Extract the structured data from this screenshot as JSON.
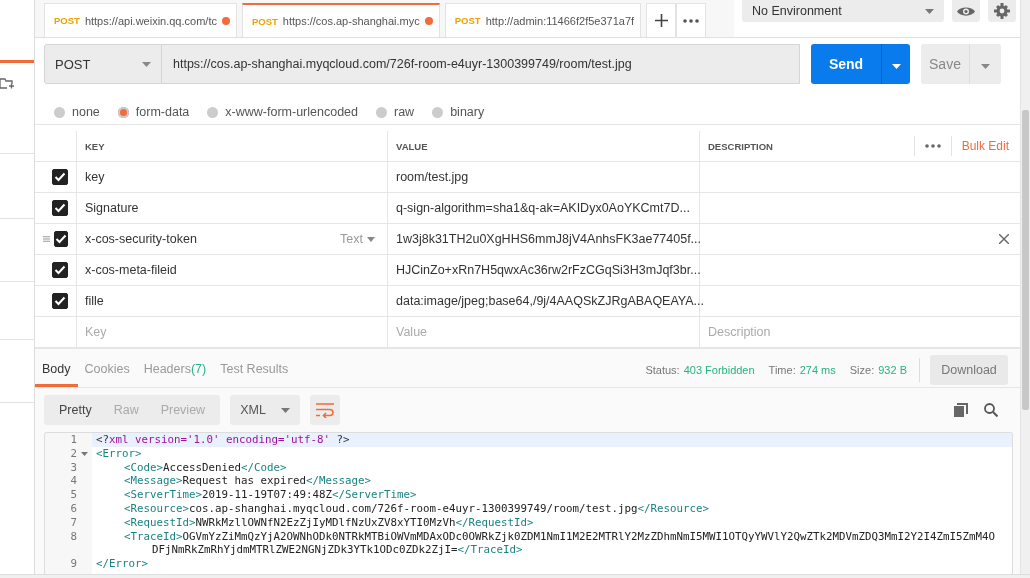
{
  "request_tabs": [
    {
      "method": "POST",
      "url": "https://api.weixin.qq.com/tc",
      "unsaved": true,
      "selected": false
    },
    {
      "method": "POST",
      "url": "https://cos.ap-shanghai.myc",
      "unsaved": true,
      "selected": true
    },
    {
      "method": "POST",
      "url": "http://admin:11466f2f5e371a7f",
      "unsaved": false,
      "selected": false
    }
  ],
  "environment": {
    "value": "No Environment"
  },
  "request": {
    "method": "POST",
    "url": "https://cos.ap-shanghai.myqcloud.com/726f-room-e4uyr-1300399749/room/test.jpg",
    "send": "Send",
    "save": "Save"
  },
  "body_types": [
    {
      "label": "none",
      "selected": false
    },
    {
      "label": "form-data",
      "selected": true
    },
    {
      "label": "x-www-form-urlencoded",
      "selected": false
    },
    {
      "label": "raw",
      "selected": false
    },
    {
      "label": "binary",
      "selected": false
    }
  ],
  "params": {
    "columns": [
      "KEY",
      "VALUE",
      "DESCRIPTION"
    ],
    "bulk_edit": "Bulk Edit",
    "rows": [
      {
        "key": "key",
        "value": "room/test.jpg",
        "checked": true,
        "hovered": false
      },
      {
        "key": "Signature",
        "value": "q-sign-algorithm=sha1&q-ak=AKIDyx0AoYKCmt7D...",
        "checked": true,
        "hovered": false
      },
      {
        "key": "x-cos-security-token",
        "type_label": "Text",
        "value": "1w3j8k31TH2u0XgHHS6mmJ8jV4AnhsFK3ae77405f...",
        "checked": true,
        "hovered": true
      },
      {
        "key": "x-cos-meta-fileid",
        "value": "HJCinZo+xRn7H5qwxAc36rw2rFzCGqSi3H3mJqf3br...",
        "checked": true,
        "hovered": false
      },
      {
        "key": "fille",
        "value": "data:image/jpeg;base64,/9j/4AAQSkZJRgABAQEAYA...",
        "checked": true,
        "hovered": false
      }
    ],
    "new_row": [
      {
        "placeholder": "Key"
      },
      {
        "placeholder": "Value"
      },
      {
        "placeholder": "Description"
      }
    ]
  },
  "response": {
    "tabs": [
      {
        "label": "Body",
        "selected": true
      },
      {
        "label": "Cookies",
        "selected": false
      },
      {
        "label": "Headers",
        "count": "(7)",
        "selected": false
      },
      {
        "label": "Test Results",
        "selected": false
      }
    ],
    "stats": [
      {
        "label": "Status:",
        "value": "403 Forbidden"
      },
      {
        "label": "Time:",
        "value": "274 ms"
      },
      {
        "label": "Size:",
        "value": "932 B"
      }
    ],
    "download": "Download",
    "views": [
      {
        "label": "Pretty",
        "selected": true
      },
      {
        "label": "Raw",
        "selected": false
      },
      {
        "label": "Preview",
        "selected": false
      }
    ],
    "format": "XML",
    "code": [
      {
        "number": "1",
        "kind": "root",
        "active": true,
        "tokens": [
          {
            "kind": "punct",
            "text": "<?"
          },
          {
            "kind": "decl",
            "text": "xml version='1.0' encoding='utf-8'"
          },
          {
            "kind": "punct",
            "text": " ?>"
          }
        ]
      },
      {
        "number": "2",
        "kind": "root",
        "fold": true,
        "tokens": [
          {
            "kind": "tag",
            "text": "<Error>"
          }
        ]
      },
      {
        "number": "3",
        "kind": "child",
        "tokens": [
          {
            "kind": "tag",
            "text": "<Code>"
          },
          {
            "kind": "text",
            "text": "AccessDenied"
          },
          {
            "kind": "tag",
            "text": "</Code>"
          }
        ]
      },
      {
        "number": "4",
        "kind": "child",
        "tokens": [
          {
            "kind": "tag",
            "text": "<Message>"
          },
          {
            "kind": "text",
            "text": "Request has expired"
          },
          {
            "kind": "tag",
            "text": "</Message>"
          }
        ]
      },
      {
        "number": "5",
        "kind": "child",
        "tokens": [
          {
            "kind": "tag",
            "text": "<ServerTime>"
          },
          {
            "kind": "text",
            "text": "2019-11-19T07:49:48Z"
          },
          {
            "kind": "tag",
            "text": "</ServerTime>"
          }
        ]
      },
      {
        "number": "6",
        "kind": "child",
        "tokens": [
          {
            "kind": "tag",
            "text": "<Resource>"
          },
          {
            "kind": "text",
            "text": "cos.ap-shanghai.myqcloud.com/726f-room-e4uyr-1300399749/room/test.jpg"
          },
          {
            "kind": "tag",
            "text": "</Resource>"
          }
        ]
      },
      {
        "number": "7",
        "kind": "child",
        "tokens": [
          {
            "kind": "tag",
            "text": "<RequestId>"
          },
          {
            "kind": "text",
            "text": "NWRkMzllOWNfN2EzZjIyMDlfNzUxZV8xYTI0MzVh"
          },
          {
            "kind": "tag",
            "text": "</RequestId>"
          }
        ]
      },
      {
        "number": "8",
        "kind": "child",
        "tokens": [
          {
            "kind": "tag",
            "text": "<TraceId>"
          },
          {
            "kind": "text",
            "text": "OGVmYzZiMmQzYjA2OWNhODk0NTRkMTBiOWVmMDAxODc0OWRkZjk0ZDM1NmI1M2E2MTRlY2MzZDhmNmI5MWI1OTQyYWVlY2QwZTk2MDVmZDQ3MmI2Y2I4ZmI5ZmM4O"
          }
        ]
      },
      {
        "kind": "wrap",
        "tokens": [
          {
            "kind": "text",
            "text": "DFjNmRkZmRhYjdmMTRlZWE2NGNjZDk3YTk1ODc0ZDk2ZjI="
          },
          {
            "kind": "tag",
            "text": "</TraceId>"
          }
        ]
      },
      {
        "number": "9",
        "kind": "root",
        "tokens": [
          {
            "kind": "tag",
            "text": "</Error>"
          }
        ]
      }
    ]
  }
}
